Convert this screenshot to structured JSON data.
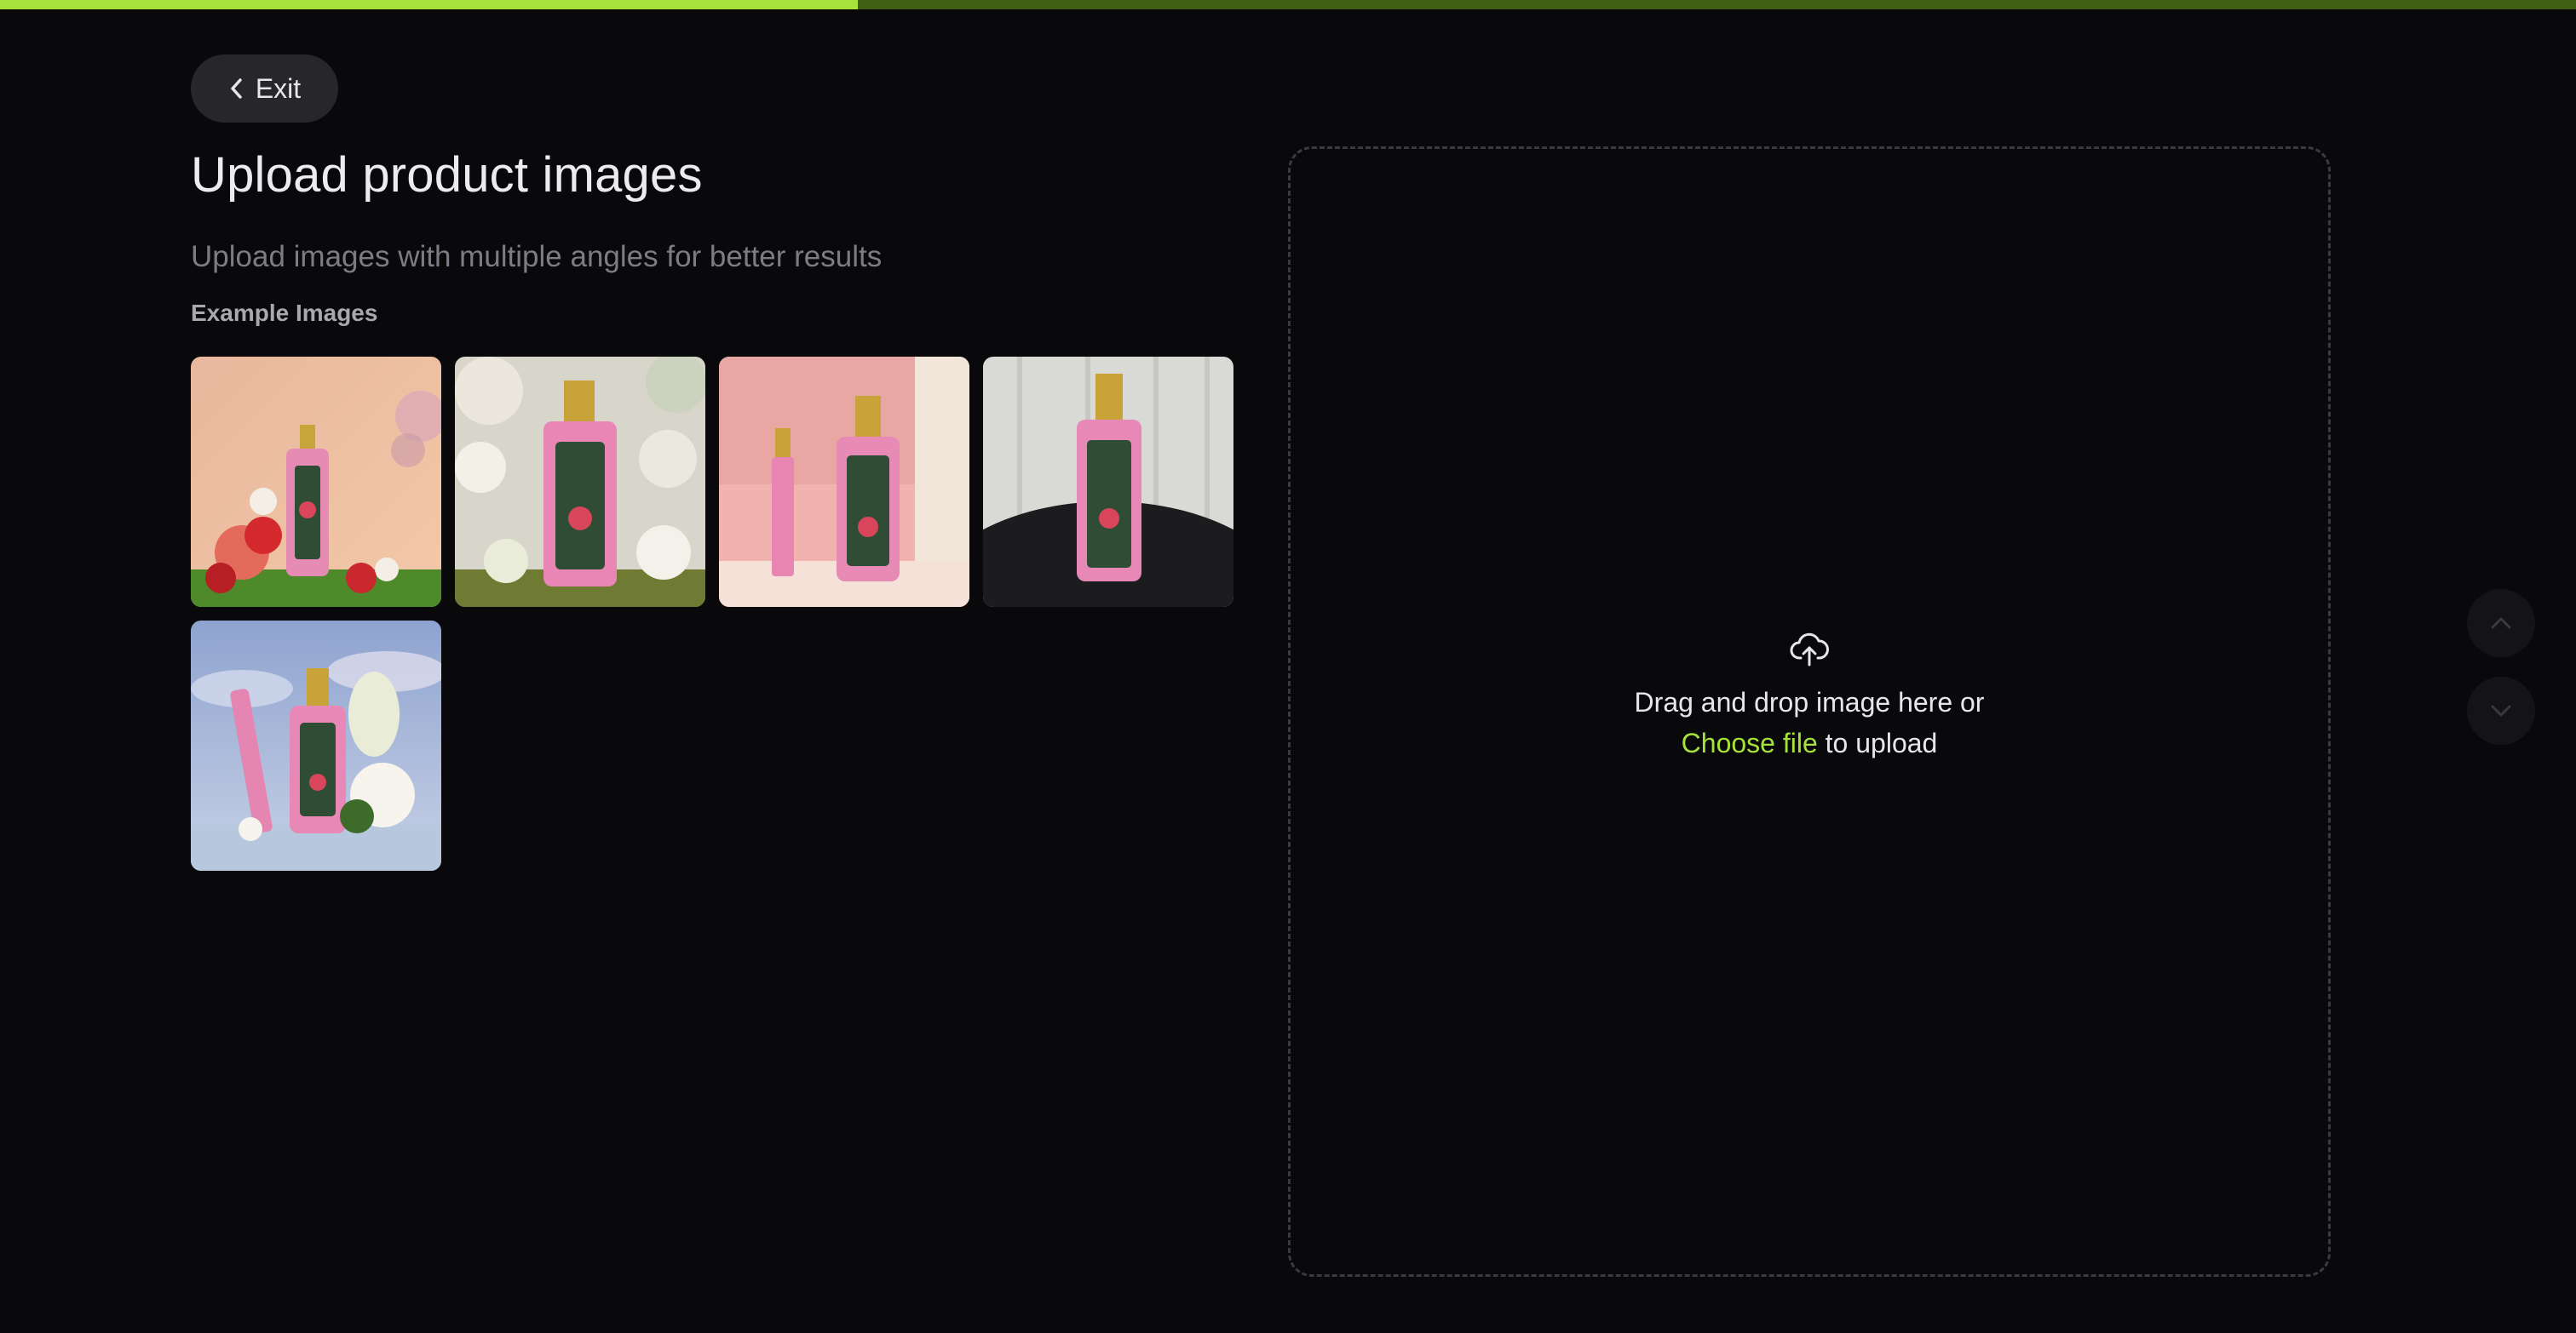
{
  "progress": {
    "fraction": 0.333,
    "fill_color": "#a6e23a",
    "track_color": "#3f5f12"
  },
  "header": {
    "exit_label": "Exit",
    "title": "Upload product images",
    "subtitle": "Upload images with multiple angles for better results"
  },
  "examples": {
    "label": "Example Images",
    "images": [
      {
        "name": "pink perfume bottle with red flowers on grass",
        "icon": "example-image"
      },
      {
        "name": "pink perfume bottle among white flowers",
        "icon": "example-image"
      },
      {
        "name": "pink perfume bottle with travel spray on pink background",
        "icon": "example-image"
      },
      {
        "name": "pink perfume bottle on dark table",
        "icon": "example-image"
      },
      {
        "name": "pink perfume bottle with gardenia under blue sky",
        "icon": "example-image"
      }
    ]
  },
  "dropzone": {
    "icon": "cloud-upload-icon",
    "line1": "Drag and drop image here or",
    "choose_label": "Choose file",
    "line2_suffix": " to upload",
    "accent_color": "#a6e23a"
  },
  "side_nav": {
    "up_icon": "chevron-up-icon",
    "down_icon": "chevron-down-icon"
  }
}
